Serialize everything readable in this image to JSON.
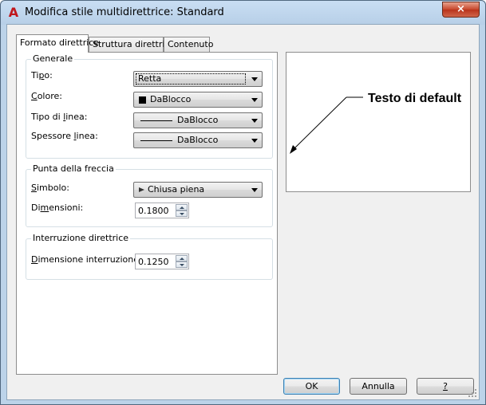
{
  "window": {
    "title": "Modifica stile multidirettrice: Standard",
    "close_glyph": "×",
    "app_icon": "autocad-a-icon",
    "app_icon_glyph": "A"
  },
  "tabs": [
    {
      "label": "Formato direttrice",
      "active": true
    },
    {
      "label": "Struttura direttrice",
      "active": false
    },
    {
      "label": "Contenuto",
      "active": false
    }
  ],
  "generale": {
    "title": "Generale",
    "tipo": {
      "label_pre": "Ti",
      "label_u": "p",
      "label_post": "o:",
      "value": "Retta"
    },
    "colore": {
      "label_pre": "",
      "label_u": "C",
      "label_post": "olore:",
      "value": "DaBlocco"
    },
    "tipo_linea": {
      "label_pre": "Tipo di ",
      "label_u": "l",
      "label_post": "inea:",
      "value": "DaBlocco"
    },
    "spessore_linea": {
      "label_pre": "Spessore ",
      "label_u": "l",
      "label_post": "inea:",
      "value": "DaBlocco"
    }
  },
  "freccia": {
    "title": "Punta della freccia",
    "simbolo": {
      "label_pre": "",
      "label_u": "S",
      "label_post": "imbolo:",
      "value": "Chiusa piena"
    },
    "dimensioni": {
      "label_pre": "Di",
      "label_u": "m",
      "label_post": "ensioni:",
      "value": "0.1800"
    }
  },
  "interruzione": {
    "title": "Interruzione direttrice",
    "dimensione": {
      "label_pre": "",
      "label_u": "D",
      "label_post": "imensione interruzione:",
      "value": "0.1250"
    }
  },
  "preview": {
    "text": "Testo di default"
  },
  "buttons": {
    "ok": "OK",
    "annulla": "Annulla",
    "help": "?"
  },
  "colors": {
    "title_bg": "#bcd3e9",
    "close_red": "#c7462a",
    "dialog_bg": "#f0f0f0",
    "group_border": "#d5dfe5"
  }
}
